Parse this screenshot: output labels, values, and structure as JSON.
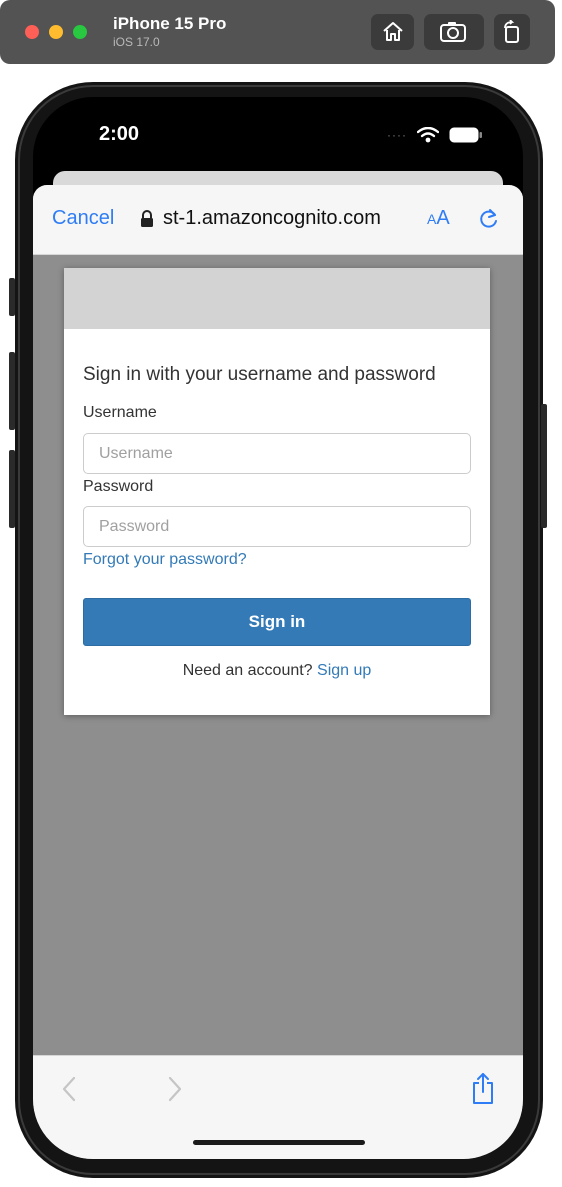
{
  "simulator": {
    "device_name": "iPhone 15 Pro",
    "os_version": "iOS 17.0",
    "icons": [
      "home-icon",
      "screenshot-icon",
      "rotate-icon"
    ]
  },
  "status_bar": {
    "time": "2:00",
    "signal": "····",
    "icons": [
      "wifi-icon",
      "battery-icon"
    ]
  },
  "browser": {
    "cancel_label": "Cancel",
    "url": "st-1.amazoncognito.com",
    "text_size_label_small": "A",
    "text_size_label_large": "A",
    "icons": [
      "lock-icon",
      "reload-icon",
      "back-icon",
      "forward-icon",
      "share-icon"
    ],
    "accent_color": "#2f7df6"
  },
  "signin_form": {
    "heading": "Sign in with your username and password",
    "username_label": "Username",
    "username_placeholder": "Username",
    "password_label": "Password",
    "password_placeholder": "Password",
    "forgot_password": "Forgot your password?",
    "submit_label": "Sign in",
    "signup_prompt": "Need an account?",
    "signup_link": "Sign up",
    "button_color": "#337ab7"
  }
}
